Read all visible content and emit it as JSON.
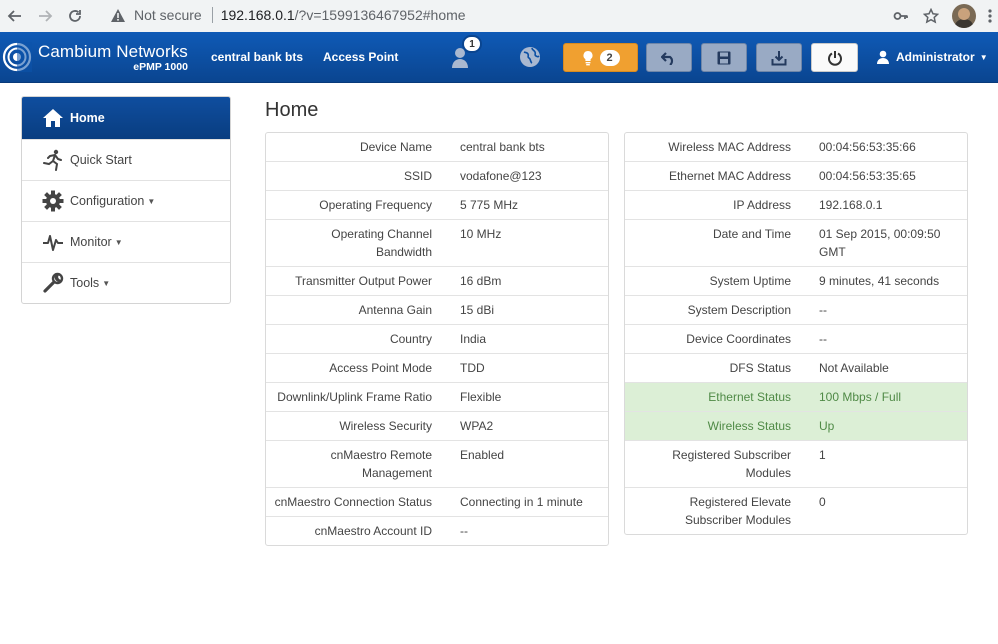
{
  "browser": {
    "not_secure": "Not secure",
    "url_host": "192.168.0.1",
    "url_rest": "/?v=1599136467952#home"
  },
  "header": {
    "brand": "Cambium Networks",
    "product": "ePMP 1000",
    "device_name_link": "central bank bts",
    "mode_link": "Access Point",
    "users_badge": "1",
    "alerts_count": "2",
    "user": "Administrator",
    "colors": {
      "header_bg": "#0b4fa3",
      "alert_btn": "#f0a030",
      "gray_btn": "#99aac4"
    }
  },
  "sidebar": {
    "items": [
      {
        "label": "Home",
        "icon": "home-icon"
      },
      {
        "label": "Quick Start",
        "icon": "running-man-icon"
      },
      {
        "label": "Configuration",
        "icon": "gear-icon"
      },
      {
        "label": "Monitor",
        "icon": "pulse-icon"
      },
      {
        "label": "Tools",
        "icon": "wrench-icon"
      }
    ]
  },
  "page": {
    "title": "Home"
  },
  "left_table": [
    {
      "key": "Device Name",
      "value": "central bank bts"
    },
    {
      "key": "SSID",
      "value": "vodafone@123"
    },
    {
      "key": "Operating Frequency",
      "value": "5 775 MHz"
    },
    {
      "key": "Operating Channel Bandwidth",
      "value": "10 MHz"
    },
    {
      "key": "Transmitter Output Power",
      "value": "16 dBm"
    },
    {
      "key": "Antenna Gain",
      "value": "15 dBi"
    },
    {
      "key": "Country",
      "value": "India"
    },
    {
      "key": "Access Point Mode",
      "value": "TDD"
    },
    {
      "key": "Downlink/Uplink Frame Ratio",
      "value": "Flexible"
    },
    {
      "key": "Wireless Security",
      "value": "WPA2"
    },
    {
      "key": "cnMaestro Remote Management",
      "value": "Enabled"
    },
    {
      "key": "cnMaestro Connection Status",
      "value": "Connecting in 1 minute"
    },
    {
      "key": "cnMaestro Account ID",
      "value": "--"
    }
  ],
  "right_table": [
    {
      "key": "Wireless MAC Address",
      "value": "00:04:56:53:35:66"
    },
    {
      "key": "Ethernet MAC Address",
      "value": "00:04:56:53:35:65"
    },
    {
      "key": "IP Address",
      "value": "192.168.0.1"
    },
    {
      "key": "Date and Time",
      "value": "01 Sep 2015, 00:09:50 GMT"
    },
    {
      "key": "System Uptime",
      "value": "9 minutes, 41 seconds"
    },
    {
      "key": "System Description",
      "value": "--"
    },
    {
      "key": "Device Coordinates",
      "value": "--"
    },
    {
      "key": "DFS Status",
      "value": "Not Available"
    },
    {
      "key": "Ethernet Status",
      "value": "100 Mbps / Full"
    },
    {
      "key": "Wireless Status",
      "value": "Up"
    },
    {
      "key": "Registered Subscriber Modules",
      "value": "1"
    },
    {
      "key": "Registered Elevate Subscriber Modules",
      "value": "0"
    }
  ]
}
